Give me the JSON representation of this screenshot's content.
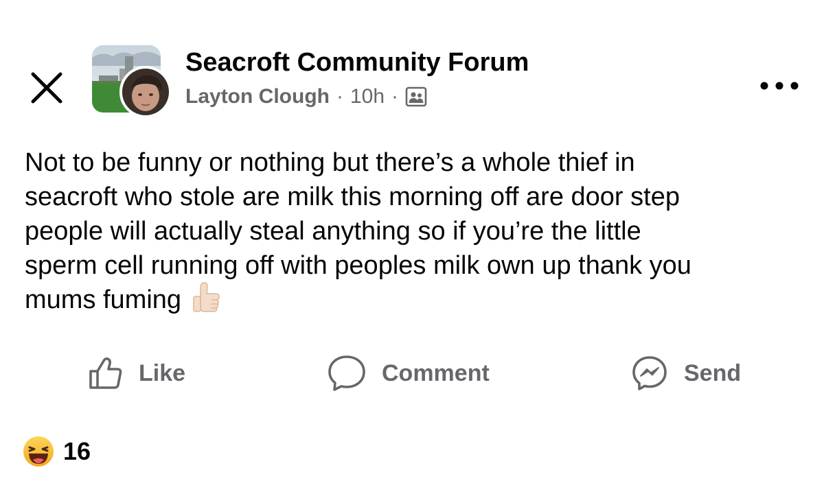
{
  "header": {
    "group_name": "Seacroft Community Forum",
    "author": "Layton Clough",
    "separator": "·",
    "time": "10h",
    "close_icon": "close-icon",
    "audience_icon": "group-members-icon",
    "more_icon": "more-horizontal-icon"
  },
  "post": {
    "lines": [
      "Not to be funny or nothing but there’s a whole thief in",
      "seacroft who stole are milk this morning off are door step",
      "people will actually steal anything so if you’re the little",
      "sperm cell running off with peoples milk own up thank you",
      "mums fuming"
    ],
    "trailing_emoji": "thumbs-up-emoji"
  },
  "actions": {
    "like": {
      "label": "Like",
      "icon": "thumbs-up-icon"
    },
    "comment": {
      "label": "Comment",
      "icon": "comment-bubble-icon"
    },
    "send": {
      "label": "Send",
      "icon": "messenger-icon"
    }
  },
  "reactions": {
    "icon": "haha-reaction-icon",
    "count": "16"
  },
  "colors": {
    "primary_text": "#050505",
    "secondary_text": "#65676b",
    "background": "#ffffff",
    "reaction_yellow": "#f7b125"
  }
}
